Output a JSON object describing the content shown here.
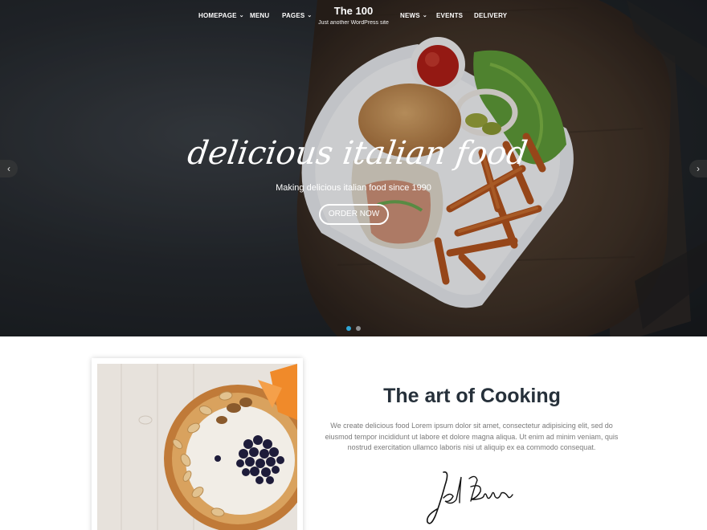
{
  "brand": {
    "title": "The 100",
    "tagline": "Just another WordPress site"
  },
  "nav": {
    "items": [
      {
        "label": "HOMEPAGE",
        "has_dropdown": true
      },
      {
        "label": "MENU",
        "has_dropdown": false
      },
      {
        "label": "PAGES",
        "has_dropdown": true
      },
      {
        "label": "NEWS",
        "has_dropdown": true
      },
      {
        "label": "EVENTS",
        "has_dropdown": false
      },
      {
        "label": "DELIVERY",
        "has_dropdown": false
      }
    ],
    "dropdown_icon": "chevron-down-icon"
  },
  "hero": {
    "title": "delicious italian food",
    "subtitle": "Making delicious italian food since 1990",
    "button": "ORDER NOW",
    "prev_icon": "chevron-left-icon",
    "next_icon": "chevron-right-icon",
    "slide_count": 2,
    "active_slide": 1,
    "colors": {
      "dot_active": "#2fa6d6",
      "dot_inactive": "#8d8f91"
    }
  },
  "about": {
    "title": "The art of Cooking",
    "text": "We create delicious food Lorem ipsum dolor sit amet, consectetur adipisicing elit, sed do eiusmod tempor incididunt ut labore et dolore magna aliqua. Ut enim ad minim veniam, quis nostrud exercitation ullamco laboris nisi ut aliquip ex ea commodo consequat.",
    "signature": "Jel Bur"
  }
}
